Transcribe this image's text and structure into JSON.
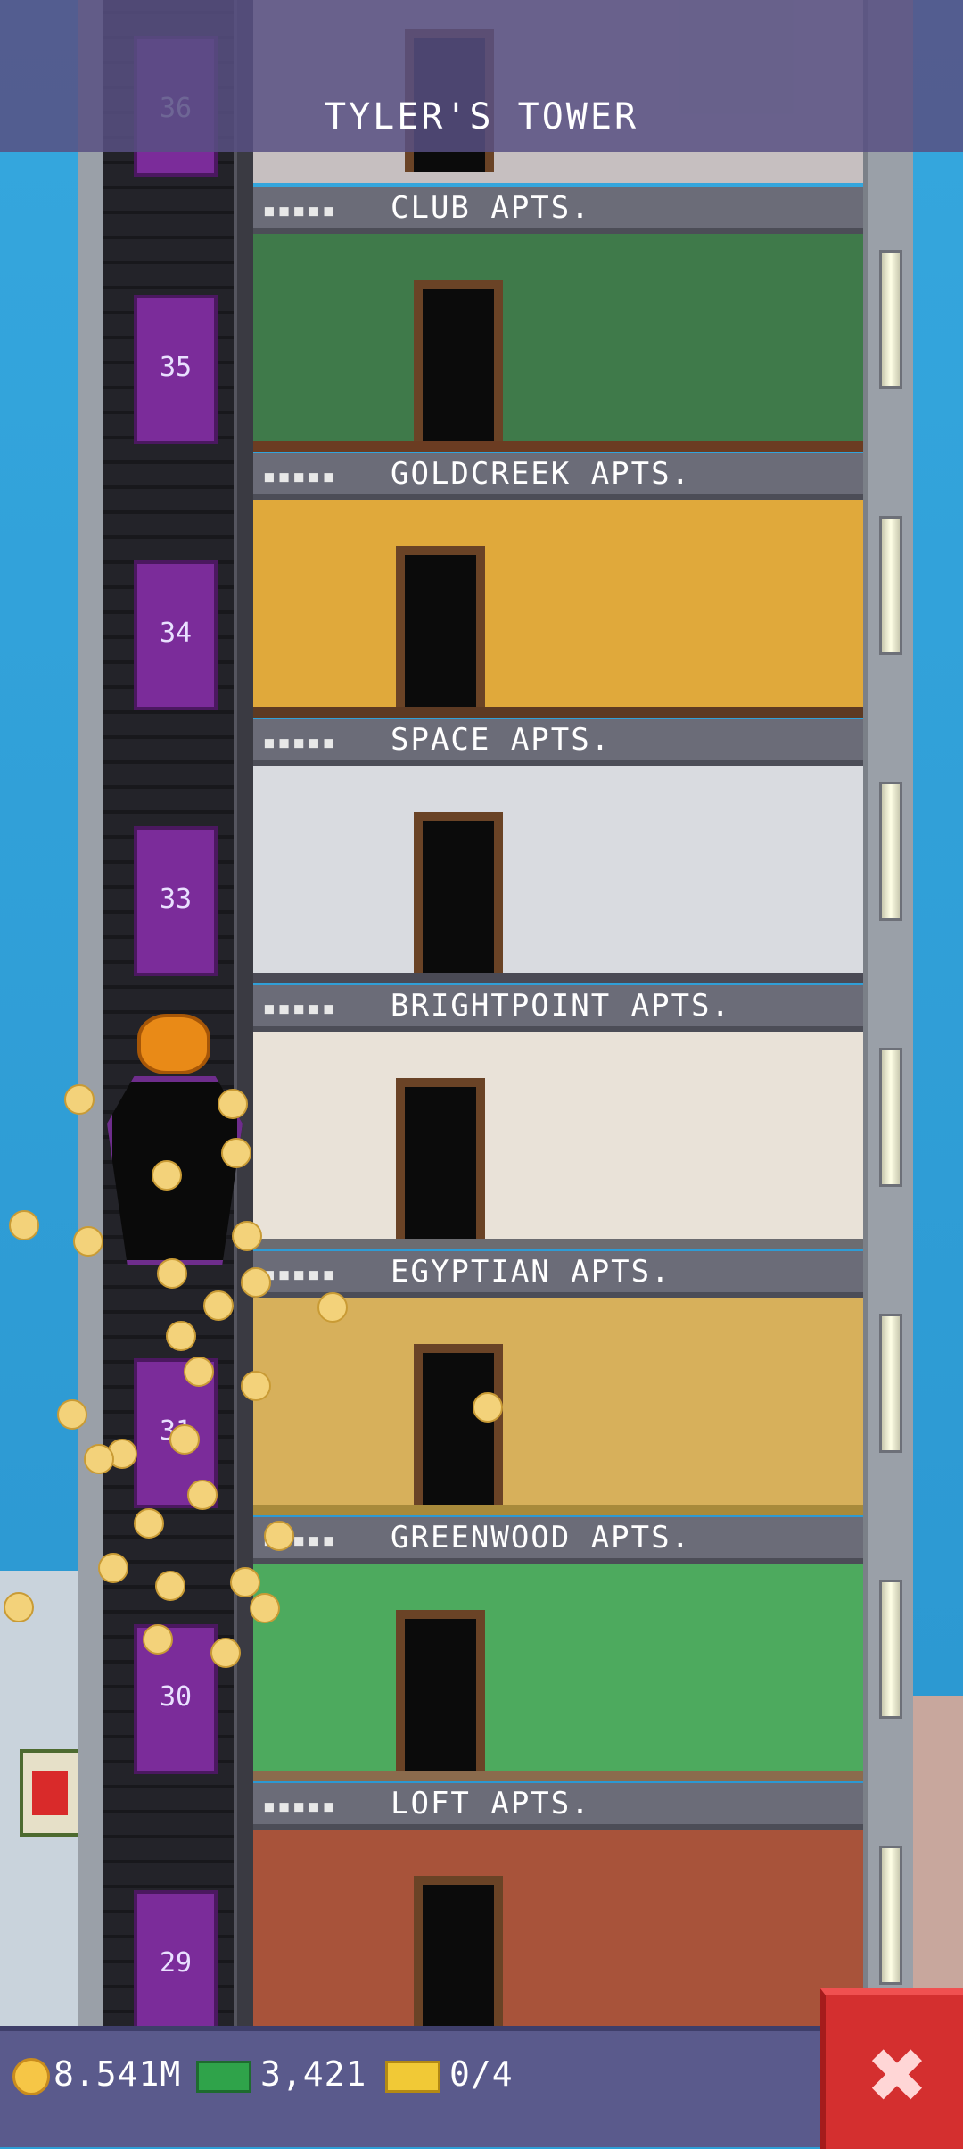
{
  "tower": {
    "name": "TYLER'S TOWER"
  },
  "floors": [
    {
      "label": "CLUB APTS.",
      "number": "35",
      "stars": "▪▪▪▪▪",
      "wall": "#3f7a4a",
      "floor": "#6b3c22"
    },
    {
      "label": "GOLDCREEK APTS.",
      "number": "34",
      "stars": "▪▪▪▪▪",
      "wall": "#e0a93b",
      "floor": "#5d3a23"
    },
    {
      "label": "SPACE APTS.",
      "number": "33",
      "stars": "▪▪▪▪▪",
      "wall": "#d9dbe0",
      "floor": "#4a4a55"
    },
    {
      "label": "BRIGHTPOINT APTS.",
      "number": "",
      "stars": "▪▪▪▪▪",
      "wall": "#e9e2d8",
      "floor": "#6c6c70"
    },
    {
      "label": "EGYPTIAN APTS.",
      "number": "31",
      "stars": "▪▪▪▪▪",
      "wall": "#d7b05b",
      "floor": "#a88a3b"
    },
    {
      "label": "GREENWOOD APTS.",
      "number": "30",
      "stars": "▪▪▪▪▪",
      "wall": "#4daa5e",
      "floor": "#8b6b4d"
    },
    {
      "label": "LOFT APTS.",
      "number": "29",
      "stars": "▪▪▪▪▪",
      "wall": "#a8533a",
      "floor": "#5b3626"
    }
  ],
  "top_floor_number": "36",
  "status": {
    "coins": "8.541M",
    "bux": "3,421",
    "tickets": "0/4"
  },
  "close_button": {
    "label": "✖"
  }
}
